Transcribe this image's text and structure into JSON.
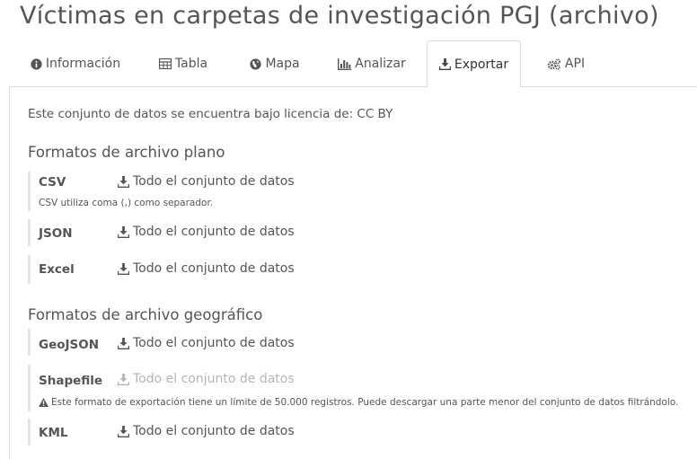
{
  "page": {
    "title": "Víctimas en carpetas de investigación PGJ (archivo)"
  },
  "tabs": [
    {
      "label": "Información",
      "icon": "info-circle-icon"
    },
    {
      "label": "Tabla",
      "icon": "table-icon"
    },
    {
      "label": "Mapa",
      "icon": "globe-icon"
    },
    {
      "label": "Analizar",
      "icon": "bar-chart-icon"
    },
    {
      "label": "Exportar",
      "icon": "download-icon",
      "active": true
    },
    {
      "label": "API",
      "icon": "cogs-icon"
    }
  ],
  "export": {
    "license_text": "Este conjunto de datos se encuentra bajo licencia de: CC BY",
    "flat_section_title": "Formatos de archivo plano",
    "geo_section_title": "Formatos de archivo geográfico",
    "download_label": "Todo el conjunto de datos",
    "formats": {
      "csv": {
        "name": "CSV",
        "note": "CSV utiliza coma (,) como separador."
      },
      "json": {
        "name": "JSON"
      },
      "excel": {
        "name": "Excel"
      },
      "geojson": {
        "name": "GeoJSON"
      },
      "shapefile": {
        "name": "Shapefile",
        "disabled": true,
        "warning": "Este formato de exportación tiene un límite de 50.000 registros. Puede descargar una parte menor del conjunto de datos filtrándolo."
      },
      "kml": {
        "name": "KML"
      }
    }
  },
  "colors": {
    "text": "#555555",
    "border": "#dddddd",
    "disabled_text": "#b5b5b5"
  }
}
